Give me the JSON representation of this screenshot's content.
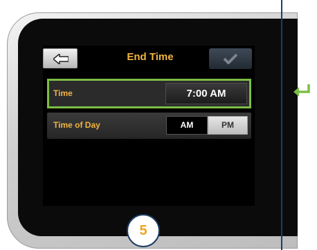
{
  "screen": {
    "title": "End Time",
    "back_icon": "arrow-left-icon",
    "confirm_icon": "checkmark-icon"
  },
  "rows": {
    "time": {
      "label": "Time",
      "value": "7:00 AM"
    },
    "time_of_day": {
      "label": "Time of Day",
      "options": [
        "AM",
        "PM"
      ],
      "selected": "AM"
    }
  },
  "step_badge": "5",
  "side_icon": "enter-arrow-icon",
  "colors": {
    "accent": "#f1b542",
    "highlight": "#7cbd45",
    "line": "#1d3c66",
    "badge_text": "#f1a31e"
  }
}
